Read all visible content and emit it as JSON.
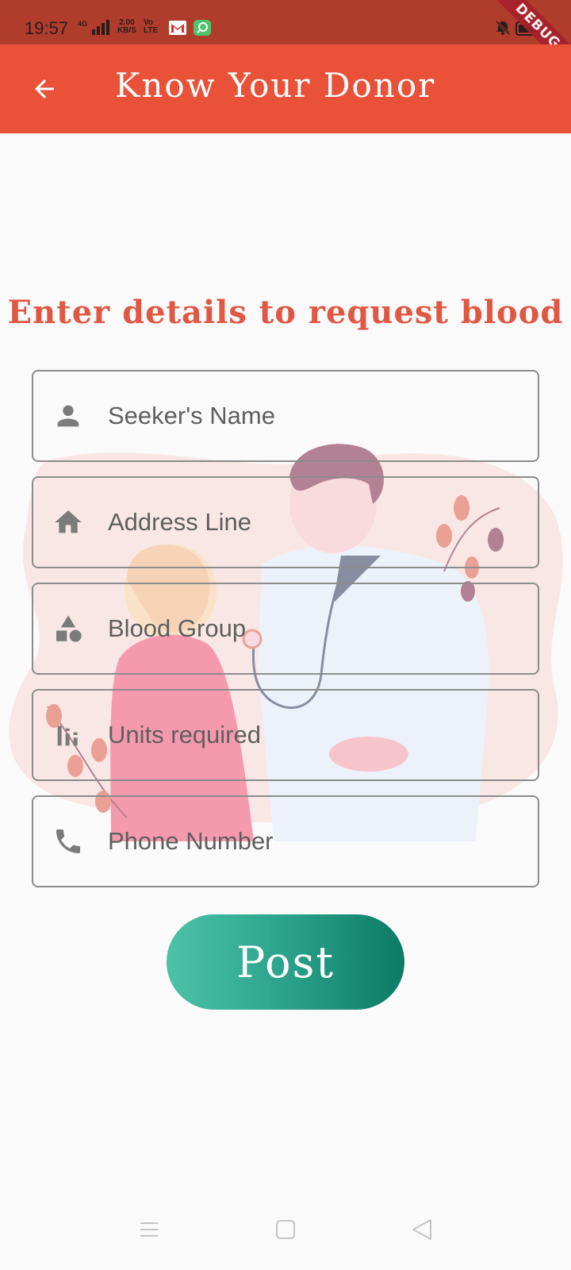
{
  "status_bar": {
    "time": "19:57",
    "network": "4G",
    "speed_value": "2.00",
    "speed_unit": "KB/S",
    "volte_top": "Vo",
    "volte_bottom": "LTE",
    "debug_label": "DEBUG"
  },
  "app_bar": {
    "title": "Know Your Donor",
    "back_icon": "arrow-left-icon",
    "background": "#e95139"
  },
  "form": {
    "heading": "Enter details to request blood",
    "fields": [
      {
        "placeholder": "Seeker's Name",
        "icon": "person-icon"
      },
      {
        "placeholder": "Address Line",
        "icon": "home-icon"
      },
      {
        "placeholder": "Blood Group",
        "icon": "category-icon"
      },
      {
        "placeholder": "Units required",
        "icon": "bar-chart-icon"
      },
      {
        "placeholder": "Phone Number",
        "icon": "phone-icon"
      }
    ],
    "submit_label": "Post"
  },
  "colors": {
    "accent": "#e05743",
    "button_start": "#4cc3a7",
    "button_end": "#0d7b63",
    "status_bar": "#b03c2b"
  },
  "nav_bar": {
    "menu_icon": "menu-icon",
    "home_icon": "square-home-icon",
    "back_icon": "triangle-back-icon"
  }
}
